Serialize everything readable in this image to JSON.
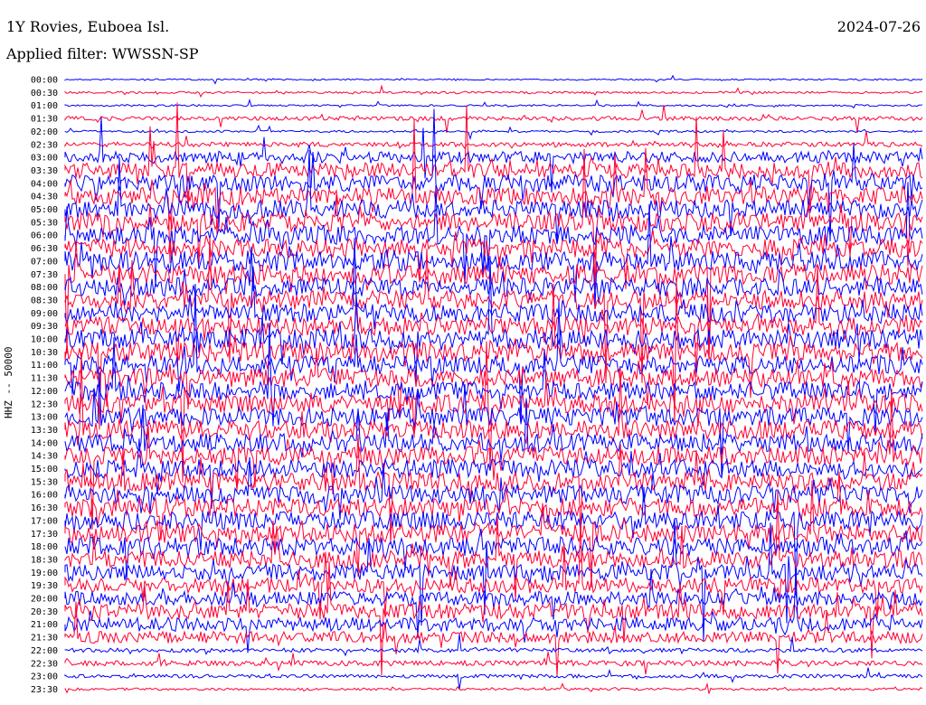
{
  "header": {
    "station": "1Y Rovies, Euboea Isl.",
    "filter": "Applied filter: WWSSN-SP",
    "date": "2024-07-26"
  },
  "chart_data": {
    "type": "line",
    "title": "1Y Rovies, Euboea Isl.",
    "subtitle": "Applied filter: WWSSN-SP",
    "date": "2024-07-26",
    "ylabel": "HHZ -- 50000",
    "xlabel": "",
    "row_labels": [
      "00:00",
      "00:30",
      "01:00",
      "01:30",
      "02:00",
      "02:30",
      "03:00",
      "03:30",
      "04:00",
      "04:30",
      "05:00",
      "05:30",
      "06:00",
      "06:30",
      "07:00",
      "07:30",
      "08:00",
      "08:30",
      "09:00",
      "09:30",
      "10:00",
      "10:30",
      "11:00",
      "11:30",
      "12:00",
      "12:30",
      "13:00",
      "13:30",
      "14:00",
      "14:30",
      "15:00",
      "15:30",
      "16:00",
      "16:30",
      "17:00",
      "17:30",
      "18:00",
      "18:30",
      "19:00",
      "19:30",
      "20:00",
      "20:30",
      "21:00",
      "21:30",
      "22:00",
      "22:30",
      "23:00",
      "23:30"
    ],
    "row_colors": [
      "#0000ff",
      "#ff0033"
    ],
    "relative_amplitude": [
      0.12,
      0.18,
      0.16,
      0.35,
      0.18,
      0.4,
      1.0,
      1.3,
      1.5,
      1.5,
      1.6,
      1.6,
      1.6,
      1.6,
      1.7,
      1.7,
      1.6,
      1.6,
      1.6,
      1.6,
      1.7,
      1.7,
      1.6,
      1.6,
      1.6,
      1.6,
      1.6,
      1.6,
      1.6,
      1.6,
      1.6,
      1.6,
      1.6,
      1.6,
      1.6,
      1.6,
      1.6,
      1.5,
      1.4,
      1.3,
      1.2,
      1.3,
      1.2,
      1.0,
      0.35,
      0.45,
      0.3,
      0.2
    ],
    "grid": false
  }
}
